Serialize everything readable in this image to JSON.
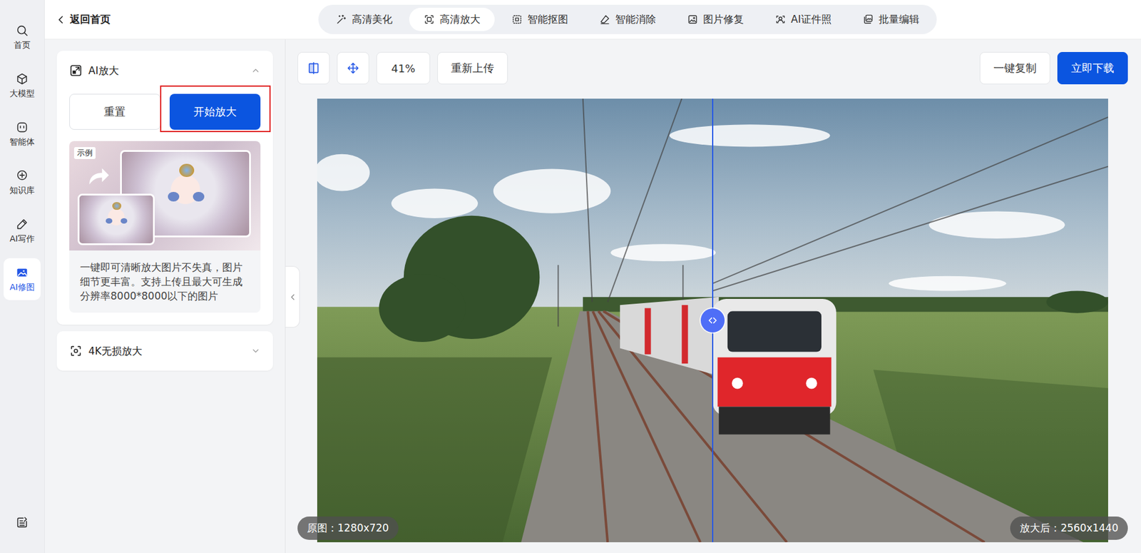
{
  "sidebar": {
    "items": [
      {
        "label": "首页",
        "selected": false
      },
      {
        "label": "大模型",
        "selected": false
      },
      {
        "label": "智能体",
        "selected": false
      },
      {
        "label": "知识库",
        "selected": false
      },
      {
        "label": "AI写作",
        "selected": false
      },
      {
        "label": "AI修图",
        "selected": true
      }
    ]
  },
  "header": {
    "back": "返回首页"
  },
  "tabs": [
    {
      "label": "高清美化",
      "selected": false
    },
    {
      "label": "高清放大",
      "selected": true
    },
    {
      "label": "智能抠图",
      "selected": false
    },
    {
      "label": "智能消除",
      "selected": false
    },
    {
      "label": "图片修复",
      "selected": false
    },
    {
      "label": "AI证件照",
      "selected": false
    },
    {
      "label": "批量编辑",
      "selected": false
    }
  ],
  "panel": {
    "sections": [
      {
        "title": "AI放大",
        "expanded": true,
        "buttons": [
          {
            "label": "重置",
            "kind": "secondary",
            "highlighted": false
          },
          {
            "label": "开始放大",
            "kind": "primary",
            "highlighted": true
          }
        ],
        "example": {
          "badge": "示例"
        },
        "description": "一键即可清晰放大图片不失真，图片细节更丰富。支持上传且最大可生成分辨率8000*8000以下的图片"
      },
      {
        "title": "4K无损放大",
        "expanded": false
      }
    ]
  },
  "toolbar": {
    "zoom": "41%",
    "reupload": "重新上传",
    "copy": "一键复制",
    "download": "立即下载"
  },
  "preview": {
    "original_label": "原图：1280x720",
    "result_label": "放大后：2560x1440",
    "split": 0.5
  }
}
